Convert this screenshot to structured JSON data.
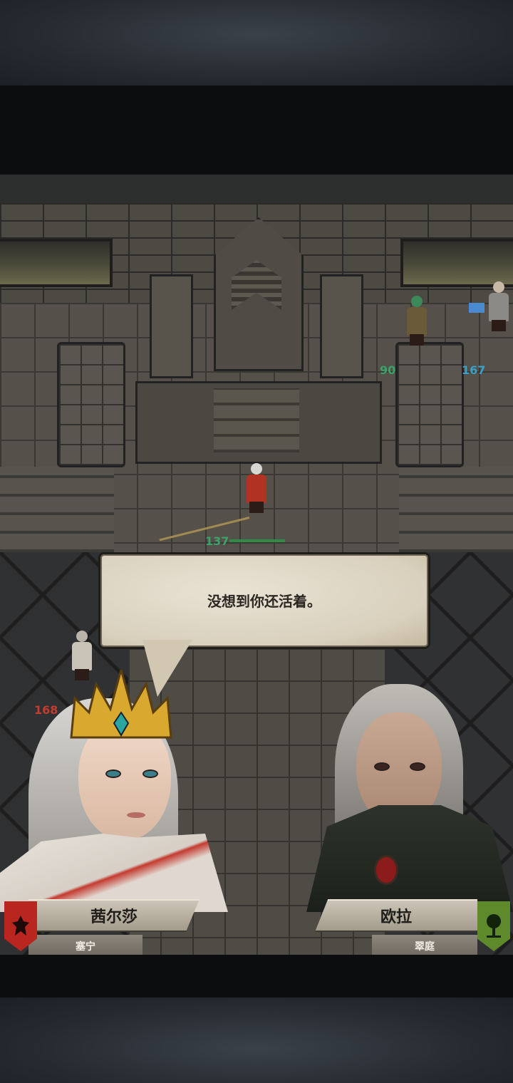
{
  "dialogue": {
    "text": "没想到你还活着。"
  },
  "speakers": {
    "left": {
      "name": "茜尔莎",
      "faction": "塞宁",
      "emblem_icon": "red-knight-emblem",
      "emblem_color": "#b8261f"
    },
    "right": {
      "name": "欧拉",
      "faction": "翠庭",
      "emblem_icon": "green-tree-emblem",
      "emblem_color": "#5f8a2b"
    }
  },
  "map_units": [
    {
      "id": "archer",
      "hp": "90",
      "hp_color": "#3aa36a"
    },
    {
      "id": "mage",
      "hp": "167",
      "hp_color": "#3aa0c8"
    },
    {
      "id": "queen",
      "hp": "137",
      "hp_color": "#3aa36a"
    },
    {
      "id": "enemy-left",
      "hp": "168",
      "hp_color": "#c43b30"
    }
  ]
}
